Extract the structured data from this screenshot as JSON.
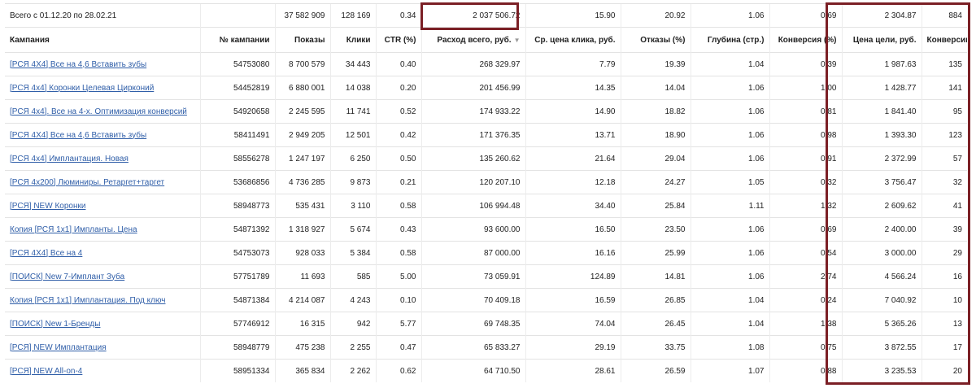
{
  "accent_color": "#7b1f25",
  "link_color": "#2f5ea8",
  "totals": {
    "label": "Всего с 01.12.20 по 28.02.21",
    "impressions": "37 582 909",
    "clicks": "128 169",
    "ctr": "0.34",
    "spend": "2 037 506.72",
    "avg_cpc": "15.90",
    "bounces": "20.92",
    "depth": "1.06",
    "conversion": "0.69",
    "goal_cost": "2 304.87",
    "conversions": "884"
  },
  "columns": {
    "campaign": "Кампания",
    "campaign_id": "№ кампании",
    "impressions": "Показы",
    "clicks": "Клики",
    "ctr": "CTR (%)",
    "spend": "Расход всего, руб.",
    "avg_cpc": "Ср. цена клика, руб.",
    "bounces": "Отказы (%)",
    "depth": "Глубина (стр.)",
    "conversion": "Конверсия (%)",
    "goal_cost": "Цена цели, руб.",
    "conversions": "Конверсии"
  },
  "sort_icon": "sort-down-triangle",
  "rows": [
    {
      "name": "[РСЯ 4Х4] Все на 4,6 Вставить зубы",
      "id": "54753080",
      "impressions": "8 700 579",
      "clicks": "34 443",
      "ctr": "0.40",
      "spend": "268 329.97",
      "avg_cpc": "7.79",
      "bounces": "19.39",
      "depth": "1.04",
      "conversion": "0.39",
      "goal_cost": "1 987.63",
      "conversions": "135"
    },
    {
      "name": "[РСЯ 4х4] Коронки Целевая Цирконий",
      "id": "54452819",
      "impressions": "6 880 001",
      "clicks": "14 038",
      "ctr": "0.20",
      "spend": "201 456.99",
      "avg_cpc": "14.35",
      "bounces": "14.04",
      "depth": "1.06",
      "conversion": "1.00",
      "goal_cost": "1 428.77",
      "conversions": "141"
    },
    {
      "name": "[РСЯ 4х4]. Все на 4-х. Оптимизация конверсий",
      "id": "54920658",
      "impressions": "2 245 595",
      "clicks": "11 741",
      "ctr": "0.52",
      "spend": "174 933.22",
      "avg_cpc": "14.90",
      "bounces": "18.82",
      "depth": "1.06",
      "conversion": "0.81",
      "goal_cost": "1 841.40",
      "conversions": "95"
    },
    {
      "name": "[РСЯ 4Х4] Все на 4,6 Вставить зубы",
      "id": "58411491",
      "impressions": "2 949 205",
      "clicks": "12 501",
      "ctr": "0.42",
      "spend": "171 376.35",
      "avg_cpc": "13.71",
      "bounces": "18.90",
      "depth": "1.06",
      "conversion": "0.98",
      "goal_cost": "1 393.30",
      "conversions": "123"
    },
    {
      "name": "[РСЯ 4х4] Имплантация. Новая",
      "id": "58556278",
      "impressions": "1 247 197",
      "clicks": "6 250",
      "ctr": "0.50",
      "spend": "135 260.62",
      "avg_cpc": "21.64",
      "bounces": "29.04",
      "depth": "1.06",
      "conversion": "0.91",
      "goal_cost": "2 372.99",
      "conversions": "57"
    },
    {
      "name": "[РСЯ 4х200] Люминиры. Ретаргет+таргет",
      "id": "53686856",
      "impressions": "4 736 285",
      "clicks": "9 873",
      "ctr": "0.21",
      "spend": "120 207.10",
      "avg_cpc": "12.18",
      "bounces": "24.27",
      "depth": "1.05",
      "conversion": "0.32",
      "goal_cost": "3 756.47",
      "conversions": "32"
    },
    {
      "name": "[РСЯ] NEW Коронки",
      "id": "58948773",
      "impressions": "535 431",
      "clicks": "3 110",
      "ctr": "0.58",
      "spend": "106 994.48",
      "avg_cpc": "34.40",
      "bounces": "25.84",
      "depth": "1.11",
      "conversion": "1.32",
      "goal_cost": "2 609.62",
      "conversions": "41"
    },
    {
      "name": "Копия [РСЯ 1х1] Импланты. Цена",
      "id": "54871392",
      "impressions": "1 318 927",
      "clicks": "5 674",
      "ctr": "0.43",
      "spend": "93 600.00",
      "avg_cpc": "16.50",
      "bounces": "23.50",
      "depth": "1.06",
      "conversion": "0.69",
      "goal_cost": "2 400.00",
      "conversions": "39"
    },
    {
      "name": "[РСЯ 4Х4] Все на 4",
      "id": "54753073",
      "impressions": "928 033",
      "clicks": "5 384",
      "ctr": "0.58",
      "spend": "87 000.00",
      "avg_cpc": "16.16",
      "bounces": "25.99",
      "depth": "1.06",
      "conversion": "0.54",
      "goal_cost": "3 000.00",
      "conversions": "29"
    },
    {
      "name": "[ПОИСК] New 7-Имплант Зуба",
      "id": "57751789",
      "impressions": "11 693",
      "clicks": "585",
      "ctr": "5.00",
      "spend": "73 059.91",
      "avg_cpc": "124.89",
      "bounces": "14.81",
      "depth": "1.06",
      "conversion": "2.74",
      "goal_cost": "4 566.24",
      "conversions": "16"
    },
    {
      "name": "Копия [РСЯ 1х1] Имплантация. Под ключ",
      "id": "54871384",
      "impressions": "4 214 087",
      "clicks": "4 243",
      "ctr": "0.10",
      "spend": "70 409.18",
      "avg_cpc": "16.59",
      "bounces": "26.85",
      "depth": "1.04",
      "conversion": "0.24",
      "goal_cost": "7 040.92",
      "conversions": "10"
    },
    {
      "name": "[ПОИСК] New 1-Бренды",
      "id": "57746912",
      "impressions": "16 315",
      "clicks": "942",
      "ctr": "5.77",
      "spend": "69 748.35",
      "avg_cpc": "74.04",
      "bounces": "26.45",
      "depth": "1.04",
      "conversion": "1.38",
      "goal_cost": "5 365.26",
      "conversions": "13"
    },
    {
      "name": "[РСЯ] NEW Имплантация",
      "id": "58948779",
      "impressions": "475 238",
      "clicks": "2 255",
      "ctr": "0.47",
      "spend": "65 833.27",
      "avg_cpc": "29.19",
      "bounces": "33.75",
      "depth": "1.08",
      "conversion": "0.75",
      "goal_cost": "3 872.55",
      "conversions": "17"
    },
    {
      "name": "[РСЯ] NEW All-on-4",
      "id": "58951334",
      "impressions": "365 834",
      "clicks": "2 262",
      "ctr": "0.62",
      "spend": "64 710.50",
      "avg_cpc": "28.61",
      "bounces": "26.59",
      "depth": "1.07",
      "conversion": "0.88",
      "goal_cost": "3 235.53",
      "conversions": "20"
    }
  ]
}
